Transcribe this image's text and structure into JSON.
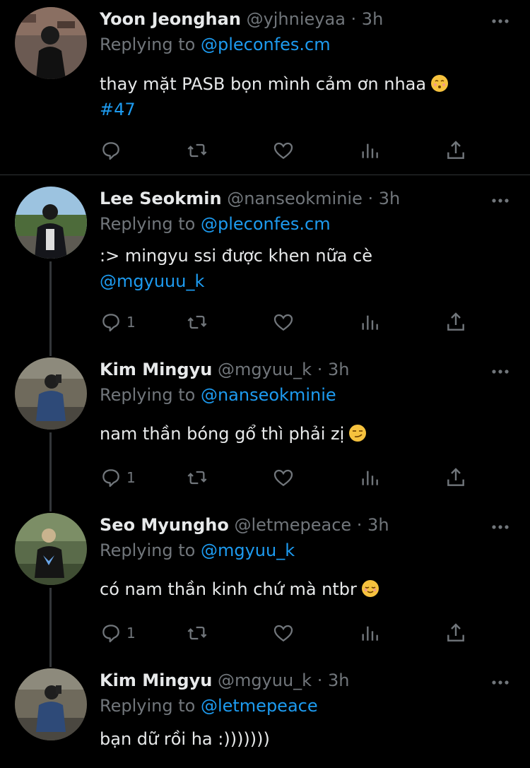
{
  "tweets": [
    {
      "name": "Yoon Jeonghan",
      "handle": "@yjhnieyaa",
      "time": "· 3h",
      "replying_prefix": "Replying to",
      "replying_to": "@pleconfes.cm",
      "text_line1": "thay mặt PASB bọn mình cảm ơn nhaa",
      "text_line2": "#47",
      "reply_count": ""
    },
    {
      "name": "Lee Seokmin",
      "handle": "@nanseokminie",
      "time": "· 3h",
      "replying_prefix": "Replying to",
      "replying_to": "@pleconfes.cm",
      "text_line1": ":> mingyu ssi được khen nữa cè",
      "text_line2": "@mgyuuu_k",
      "reply_count": "1"
    },
    {
      "name": "Kim Mingyu",
      "handle": "@mgyuu_k",
      "time": "· 3h",
      "replying_prefix": "Replying to",
      "replying_to": "@nanseokminie",
      "text_line1": "nam thần bóng gổ thì phải zị",
      "reply_count": "1"
    },
    {
      "name": "Seo Myungho",
      "handle": "@letmepeace",
      "time": "· 3h",
      "replying_prefix": "Replying to",
      "replying_to": "@mgyuu_k",
      "text_line1": "có nam thần kinh chứ mà ntbr",
      "reply_count": "1"
    },
    {
      "name": "Kim Mingyu",
      "handle": "@mgyuu_k",
      "time": "· 3h",
      "replying_prefix": "Replying to",
      "replying_to": "@letmepeace",
      "text_line1": "bạn dữ rồi ha :)))))))"
    }
  ],
  "colors": {
    "background": "#000000",
    "text": "#e7e9ea",
    "secondary": "#71767b",
    "link": "#1d9bf0",
    "divider": "#2f3336"
  },
  "icons": [
    "reply-icon",
    "retweet-icon",
    "like-icon",
    "analytics-icon",
    "share-icon",
    "more-icon"
  ]
}
